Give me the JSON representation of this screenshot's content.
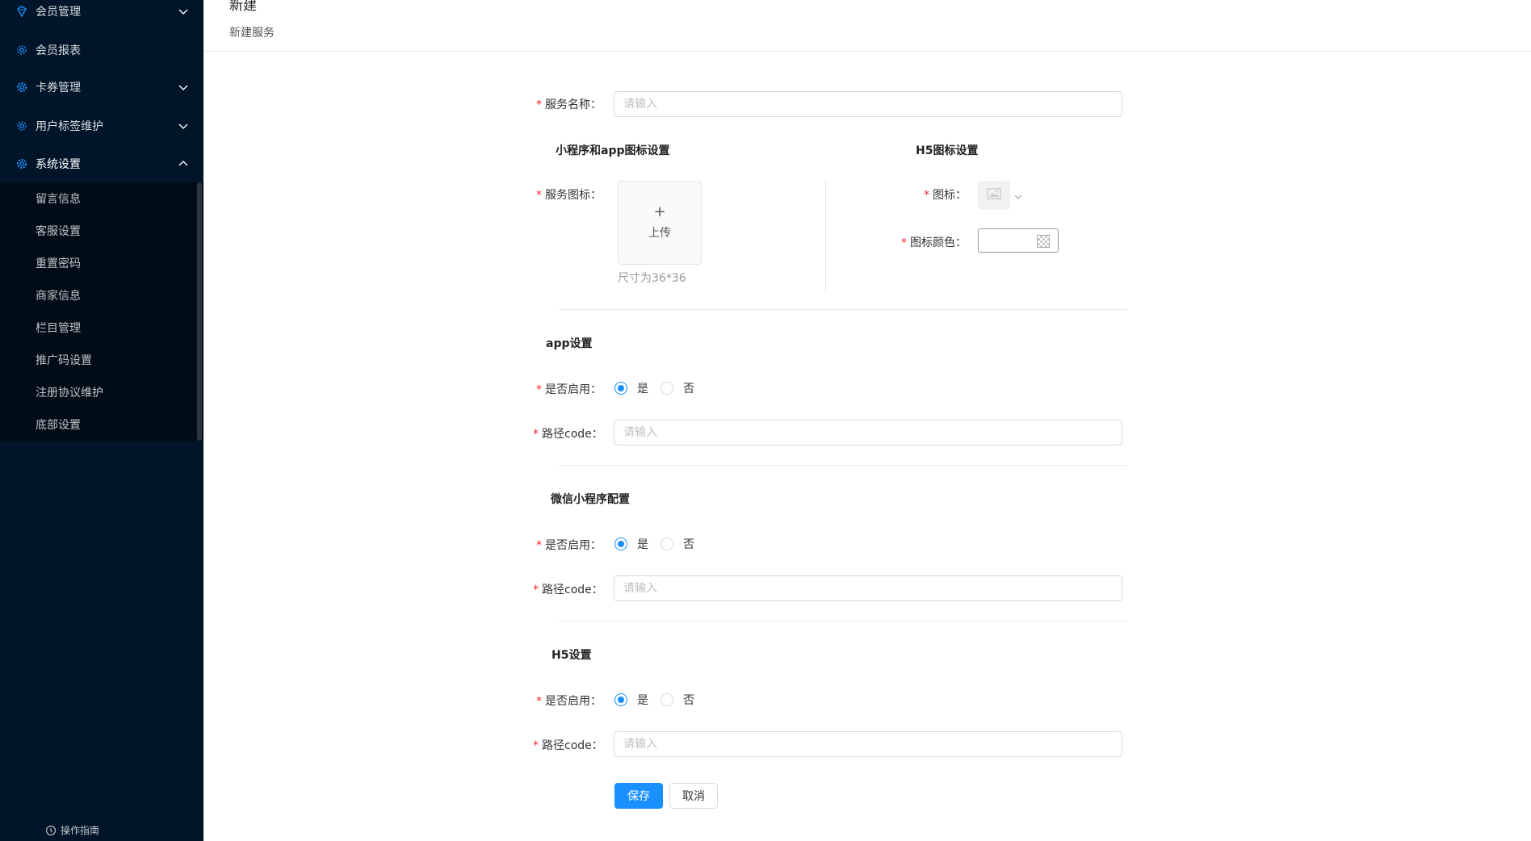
{
  "sidebar": {
    "menu": [
      {
        "label": "会员管理",
        "icon": "member-icon",
        "expanded": false
      },
      {
        "label": "会员报表",
        "icon": "report-gear-icon",
        "expanded": null
      },
      {
        "label": "卡券管理",
        "icon": "coupon-gear-icon",
        "expanded": false
      },
      {
        "label": "用户标签维护",
        "icon": "tag-gear-icon",
        "expanded": false
      },
      {
        "label": "系统设置",
        "icon": "settings-gear-icon",
        "expanded": true
      }
    ],
    "submenu": [
      {
        "label": "留言信息"
      },
      {
        "label": "客服设置"
      },
      {
        "label": "重置密码"
      },
      {
        "label": "商家信息"
      },
      {
        "label": "栏目管理"
      },
      {
        "label": "推广码设置"
      },
      {
        "label": "注册协议维护"
      },
      {
        "label": "底部设置"
      }
    ],
    "guide_label": "操作指南"
  },
  "header": {
    "title": "新建",
    "subtitle": "新建服务"
  },
  "form": {
    "service_name": {
      "label": "服务名称：",
      "placeholder": "请输入"
    },
    "mini_app_icon_section": "小程序和app图标设置",
    "h5_icon_section": "H5图标设置",
    "service_icon": {
      "label": "服务图标：",
      "upload_plus": "+",
      "upload_label": "上传",
      "hint": "尺寸为36*36"
    },
    "h5_icon": {
      "label": "图标：",
      "icon": "image-placeholder-icon"
    },
    "h5_icon_color": {
      "label": "图标颜色："
    },
    "sections": [
      {
        "title": "app设置",
        "enable_label": "是否启用：",
        "yes": "是",
        "no": "否",
        "enabled": true,
        "path_label": "路径code：",
        "path_placeholder": "请输入"
      },
      {
        "title": "微信小程序配置",
        "enable_label": "是否启用：",
        "yes": "是",
        "no": "否",
        "enabled": true,
        "path_label": "路径code：",
        "path_placeholder": "请输入"
      },
      {
        "title": "H5设置",
        "enable_label": "是否启用：",
        "yes": "是",
        "no": "否",
        "enabled": true,
        "path_label": "路径code：",
        "path_placeholder": "请输入"
      }
    ],
    "save_label": "保存",
    "cancel_label": "取消"
  },
  "colors": {
    "sidebar_bg": "#001529",
    "submenu_bg": "#000c17",
    "primary": "#1890ff",
    "required": "#f5222d"
  }
}
